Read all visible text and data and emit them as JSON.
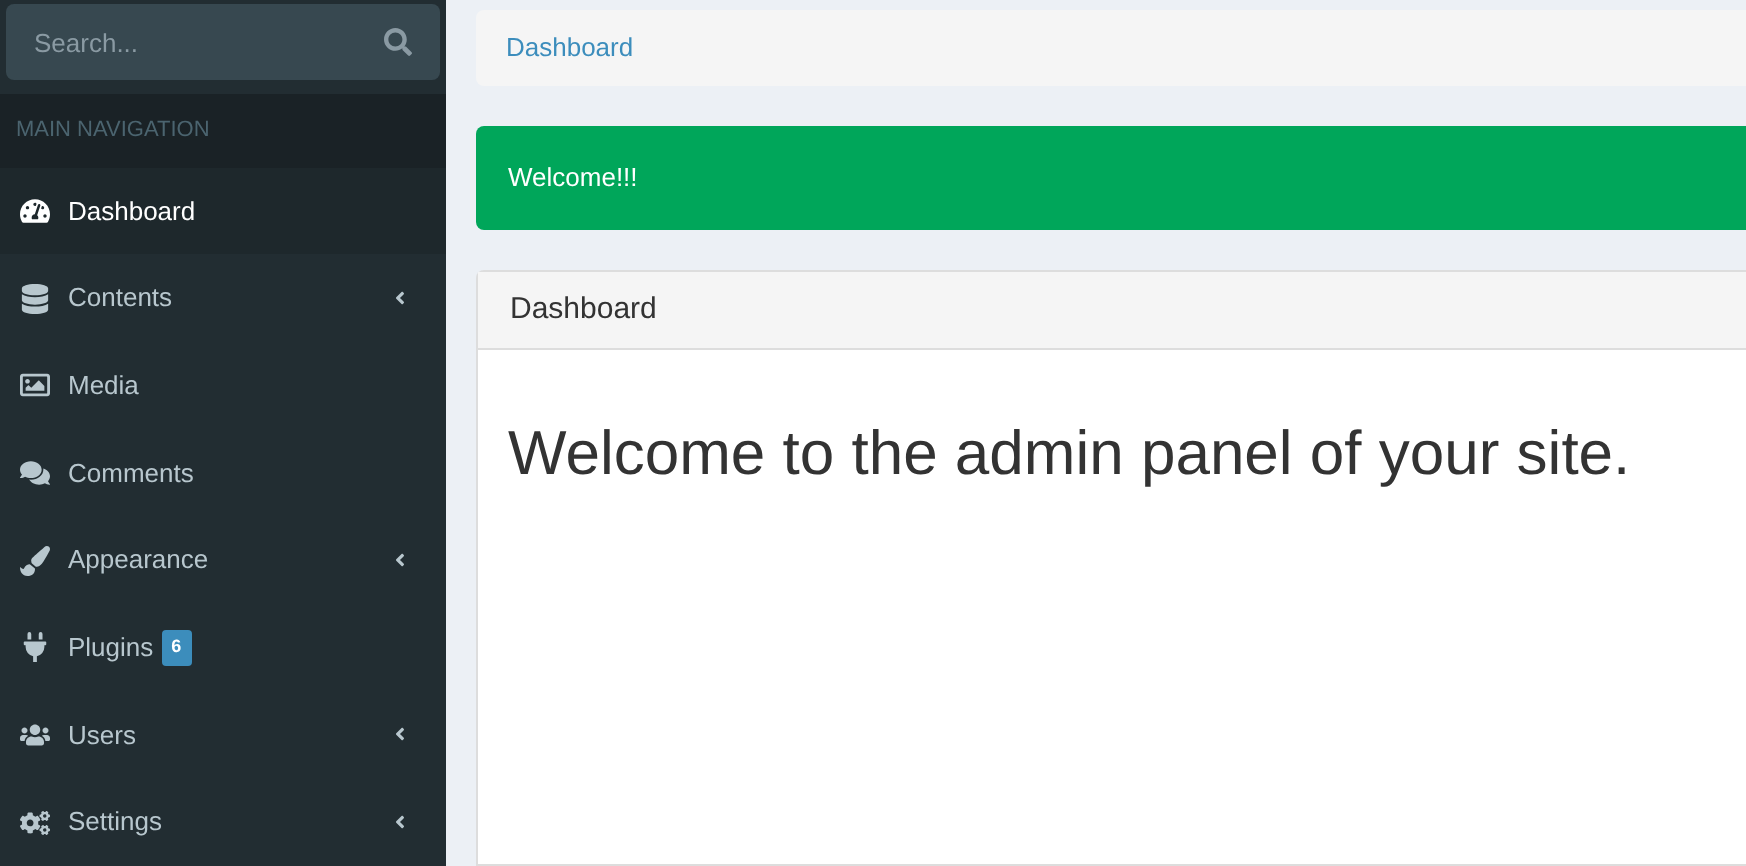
{
  "sidebar": {
    "search": {
      "placeholder": "Search..."
    },
    "header": "MAIN NAVIGATION",
    "items": [
      {
        "label": "Dashboard",
        "selected": true,
        "has_submenu": false
      },
      {
        "label": "Contents",
        "selected": false,
        "has_submenu": true
      },
      {
        "label": "Media",
        "selected": false,
        "has_submenu": false
      },
      {
        "label": "Comments",
        "selected": false,
        "has_submenu": false
      },
      {
        "label": "Appearance",
        "selected": false,
        "has_submenu": true
      },
      {
        "label": "Plugins",
        "selected": false,
        "has_submenu": false,
        "badge": "6"
      },
      {
        "label": "Users",
        "selected": false,
        "has_submenu": true
      },
      {
        "label": "Settings",
        "selected": false,
        "has_submenu": true
      }
    ]
  },
  "breadcrumb": [
    "Dashboard"
  ],
  "alert": {
    "text": "Welcome!!!"
  },
  "box": {
    "title": "Dashboard",
    "heading": "Welcome to the admin panel of your site."
  }
}
